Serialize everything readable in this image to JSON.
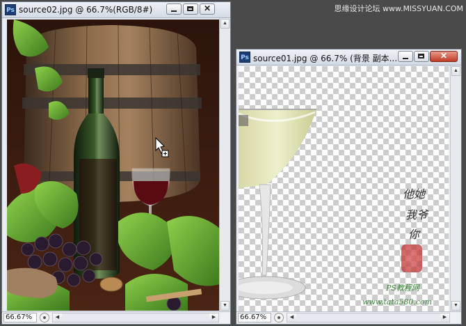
{
  "watermark": "思缘设计论坛 www.MISSYUAN.COM",
  "window_left": {
    "app_icon": "Ps",
    "title": "source02.jpg @ 66.7%(RGB/8#)",
    "zoom": "66.67%",
    "buttons": {
      "minimize": "minimize-icon",
      "maximize": "maximize-icon",
      "close": "close-icon"
    }
  },
  "window_right": {
    "app_icon": "Ps",
    "title": "source01.jpg @ 66.7% (背景 副本...",
    "zoom": "66.67%",
    "close_glyph": "✕",
    "signature_line1": "他她",
    "signature_line2": "我爷",
    "signature_line3": "你",
    "ps_site": "PS教程网",
    "ps_url": "www.tata580.com"
  },
  "colors": {
    "accent_close": "#c03c26",
    "title_bar": "#dfe4ec",
    "transparency": "#cdcdcd"
  }
}
